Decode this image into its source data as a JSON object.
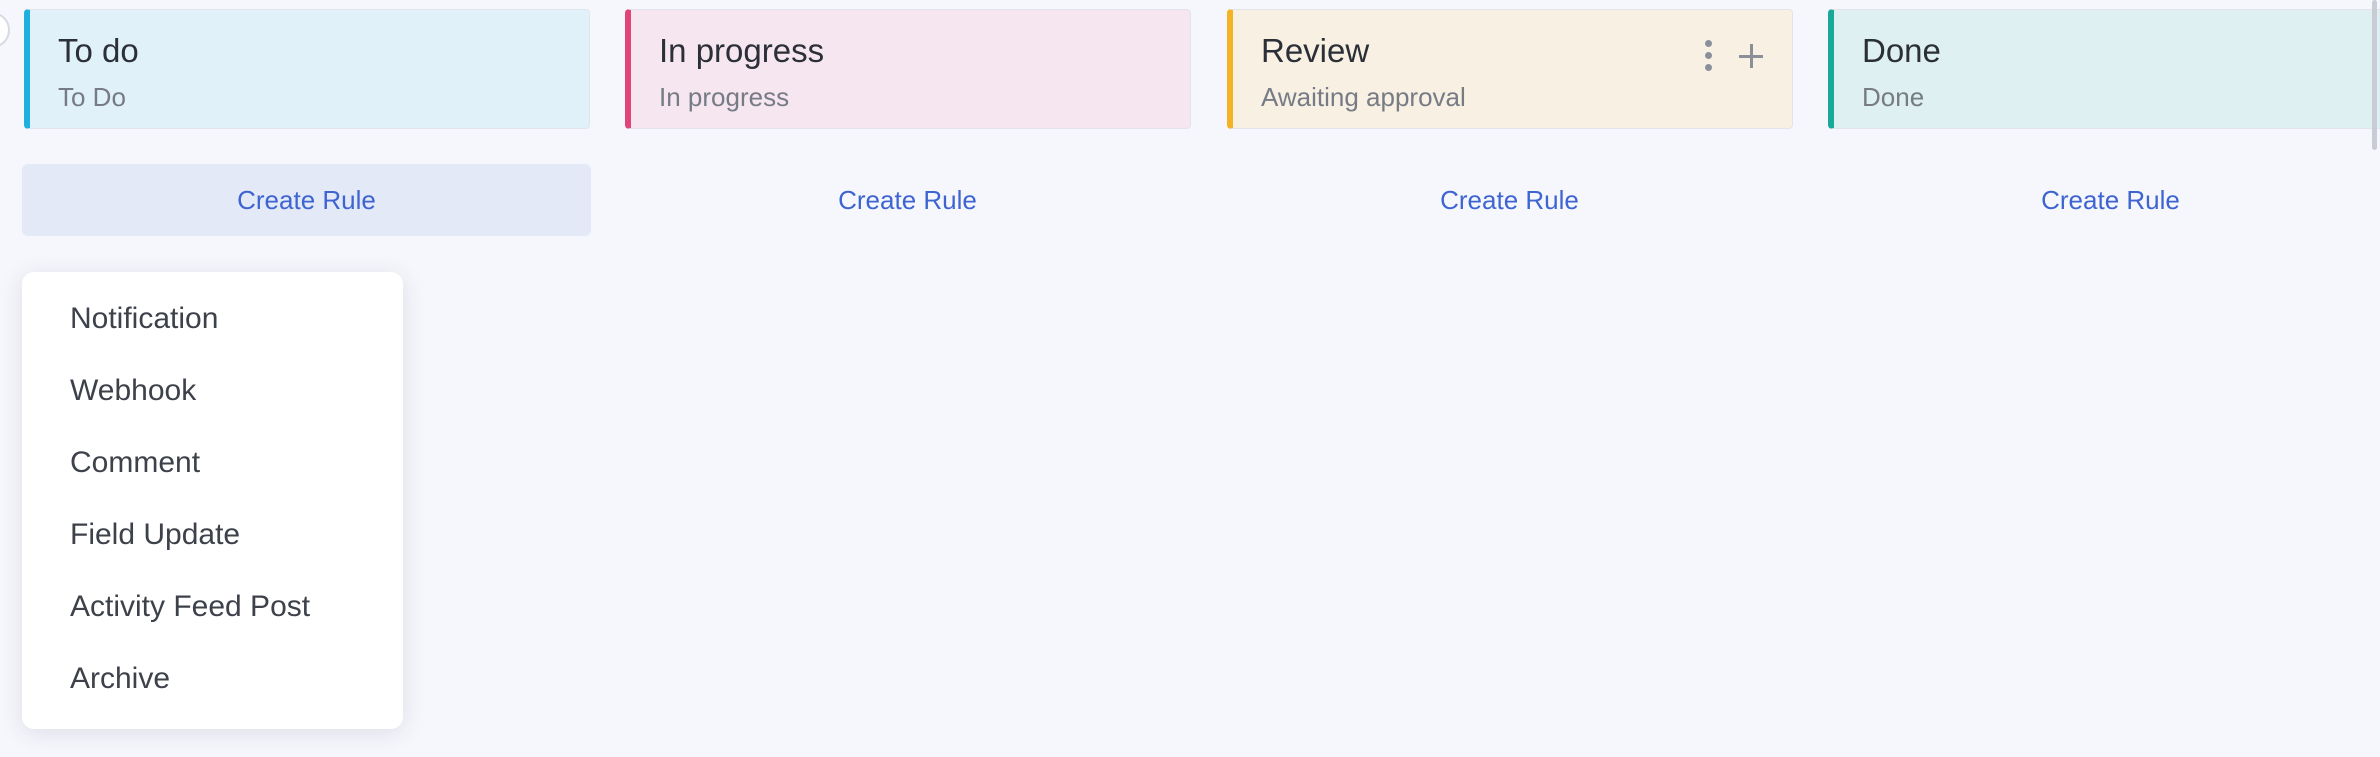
{
  "columns": [
    {
      "title": "To do",
      "subtitle": "To Do",
      "accent": "#1fb0e0",
      "bg": "#e1f1f9"
    },
    {
      "title": "In progress",
      "subtitle": "In progress",
      "accent": "#e0457a",
      "bg": "#f6e6ef"
    },
    {
      "title": "Review",
      "subtitle": "Awaiting approval",
      "accent": "#f5b324",
      "bg": "#f8f1e3",
      "icons": [
        "more-vertical-icon",
        "plus-icon"
      ]
    },
    {
      "title": "Done",
      "subtitle": "Done",
      "accent": "#19a998",
      "bg": "#def0f1"
    }
  ],
  "create_rule_label": "Create Rule",
  "rule_menu": {
    "items": [
      "Notification",
      "Webhook",
      "Comment",
      "Field Update",
      "Activity Feed Post",
      "Archive"
    ]
  },
  "colors": {
    "link": "#3e64d2",
    "page_bg": "#f6f7fc",
    "active_button_bg": "#e3e9f7"
  }
}
